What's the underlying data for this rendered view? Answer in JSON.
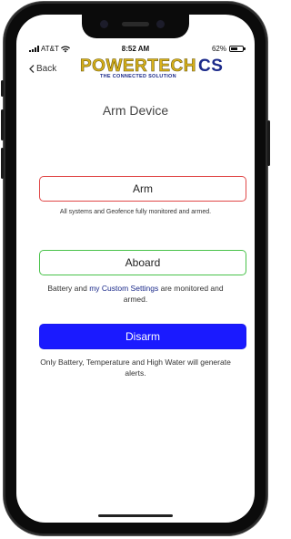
{
  "status_bar": {
    "carrier": "AT&T",
    "time": "8:52 AM",
    "battery_text": "62%",
    "battery_level": 0.62,
    "wifi_icon": "wifi-icon"
  },
  "nav": {
    "back_label": "Back"
  },
  "logo": {
    "brand_main": "POWERTECH",
    "brand_suffix": "CS",
    "tagline": "THE CONNECTED SOLUTION",
    "colors": {
      "main": "#d9b21a",
      "suffix": "#1b2a8a"
    }
  },
  "page": {
    "title": "Arm Device"
  },
  "actions": {
    "arm": {
      "label": "Arm",
      "description": "All systems and Geofence fully monitored and armed.",
      "border_color": "#e04848"
    },
    "abort": {
      "label": "Aboard",
      "description_pre": "Battery and ",
      "description_link": "my Custom Settings",
      "description_post": " are monitored and armed.",
      "border_color": "#49c24a"
    },
    "disarm": {
      "label": "Disarm",
      "description": "Only Battery, Temperature and High Water will generate alerts.",
      "background_color": "#1a1aff"
    }
  }
}
